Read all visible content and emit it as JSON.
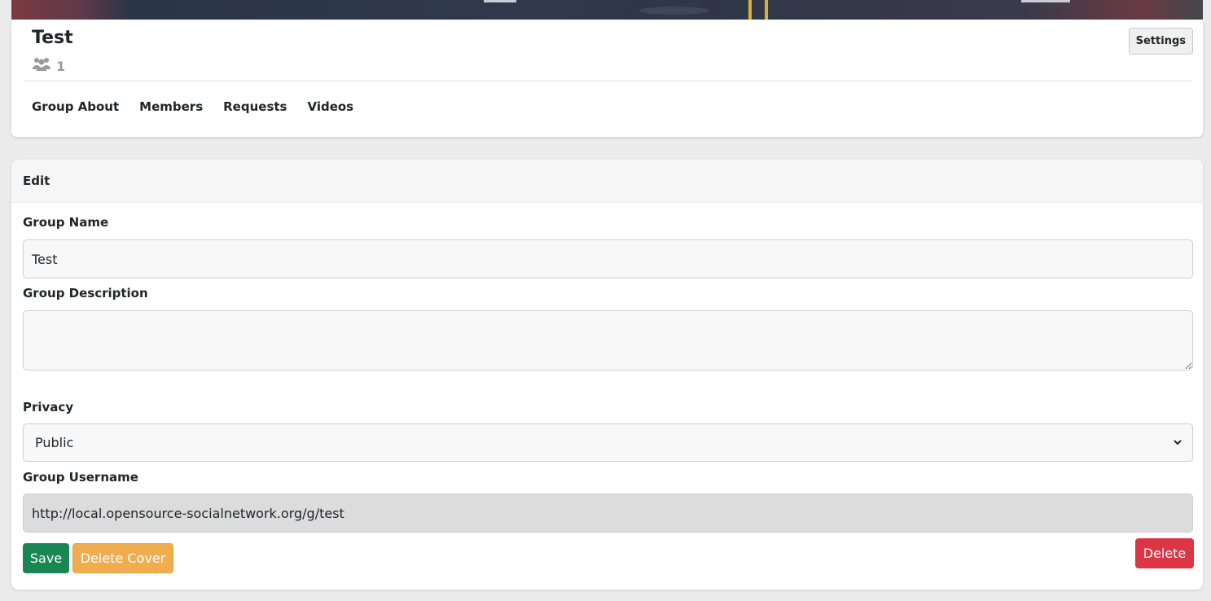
{
  "group": {
    "title": "Test",
    "member_count": "1",
    "settings_label": "Settings"
  },
  "tabs": [
    {
      "label": "Group About"
    },
    {
      "label": "Members"
    },
    {
      "label": "Requests"
    },
    {
      "label": "Videos"
    }
  ],
  "edit": {
    "heading": "Edit",
    "name_label": "Group Name",
    "name_value": "Test",
    "description_label": "Group Description",
    "description_value": "",
    "privacy_label": "Privacy",
    "privacy_selected": "Public",
    "username_label": "Group Username",
    "username_value": "http://local.opensource-socialnetwork.org/g/test"
  },
  "actions": {
    "save_label": "Save",
    "delete_cover_label": "Delete Cover",
    "delete_label": "Delete"
  },
  "colors": {
    "save": "#198754",
    "delete_cover": "#f0ad4e",
    "delete": "#dc3545",
    "page_bg": "#ebebeb"
  },
  "icons": {
    "members": "users-icon",
    "select": "chevron-down-icon"
  }
}
